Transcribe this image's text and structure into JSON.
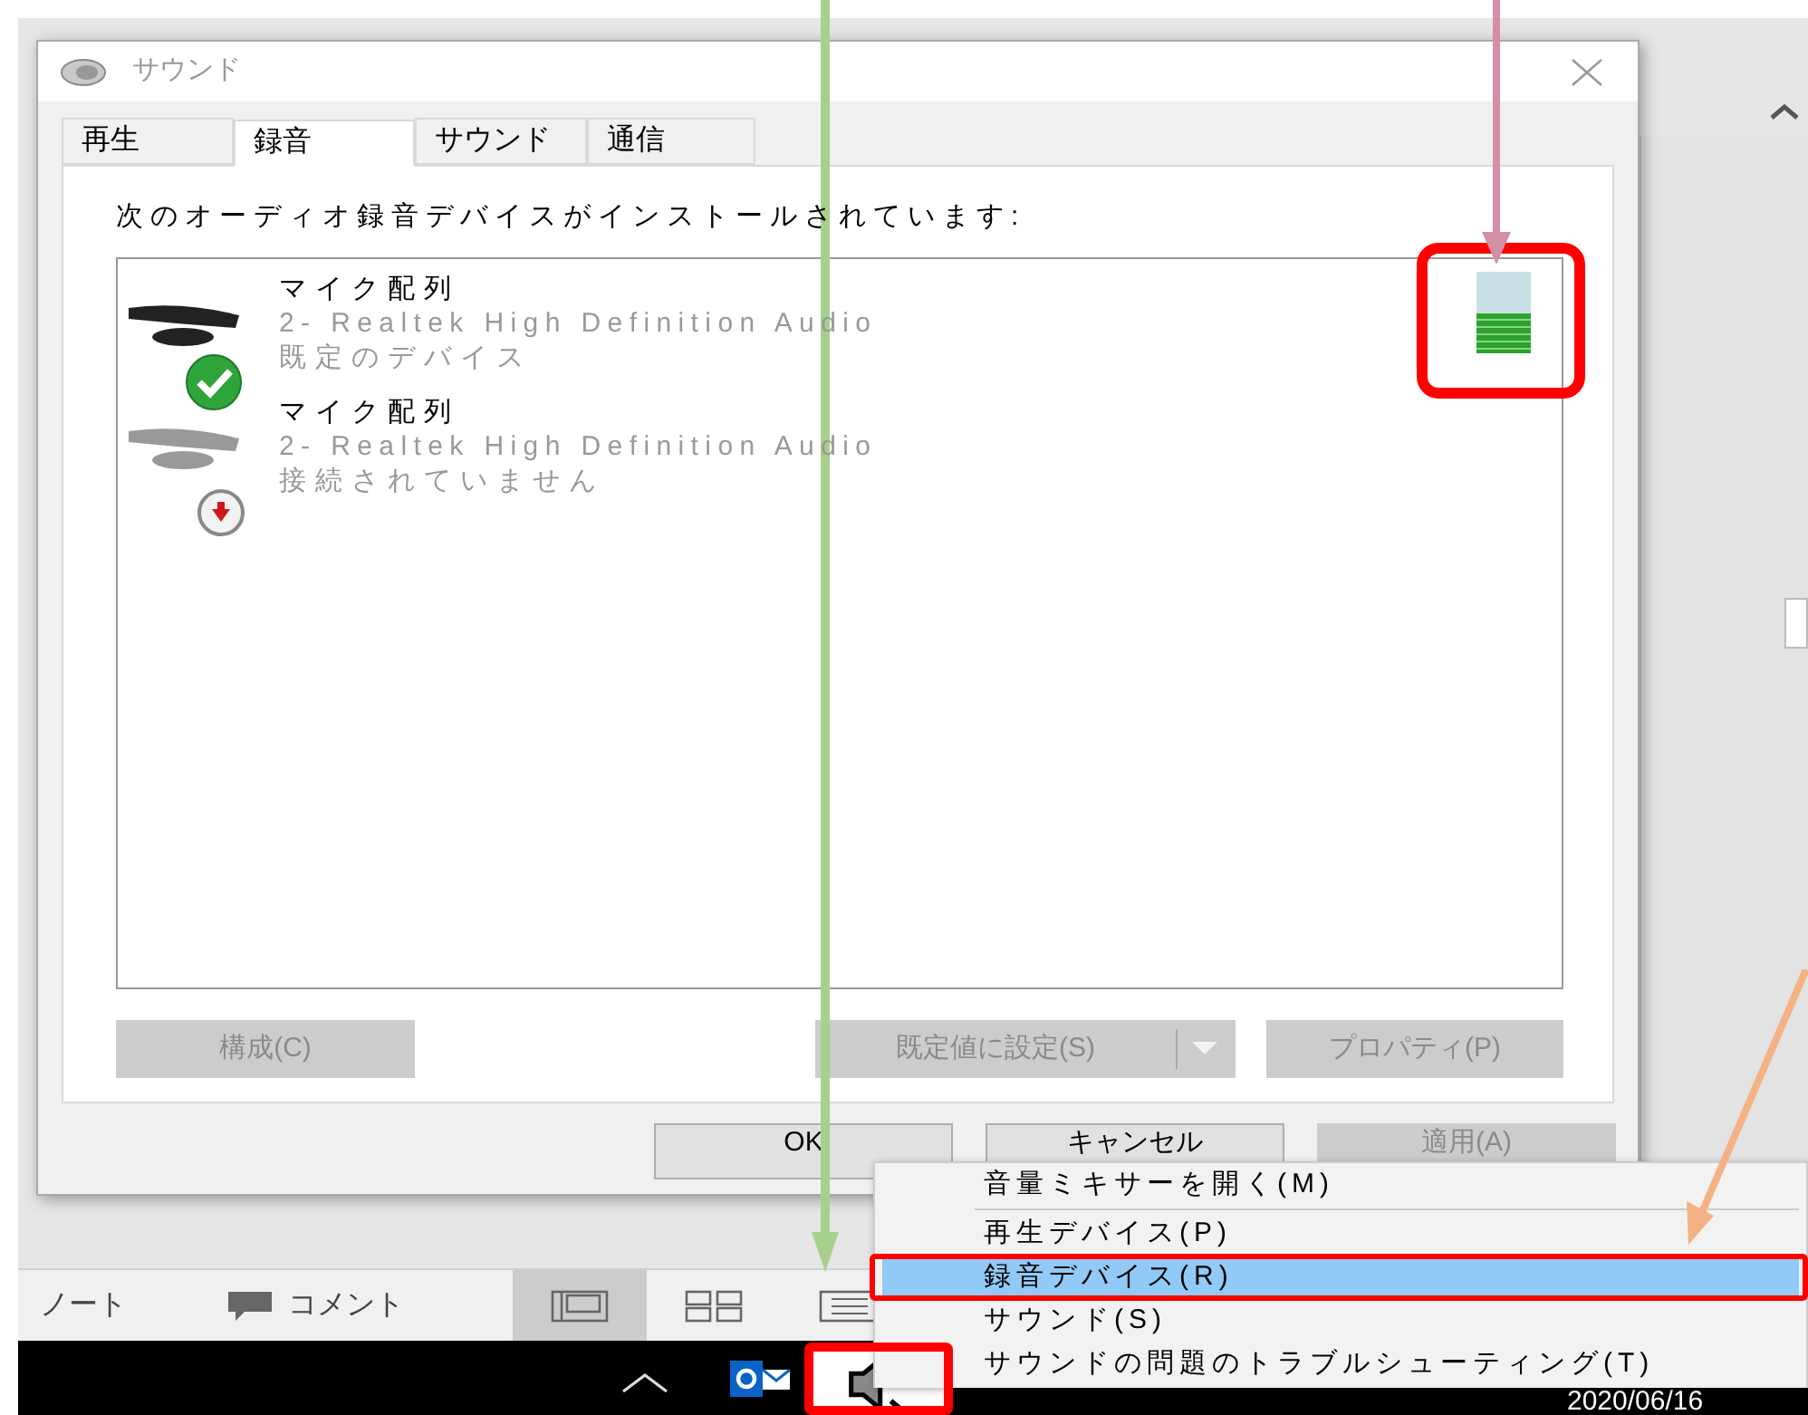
{
  "dialog": {
    "title": "サウンド",
    "tabs": [
      {
        "label": "再生",
        "selected": false
      },
      {
        "label": "録音",
        "selected": true
      },
      {
        "label": "サウンド",
        "selected": false
      },
      {
        "label": "通信",
        "selected": false
      }
    ],
    "heading": "次のオーディオ録音デバイスがインストールされています:",
    "devices": [
      {
        "name": "マイク配列",
        "driver": "2- Realtek High Definition Audio",
        "status": "既定のデバイス",
        "kind": "default",
        "level": 0.5
      },
      {
        "name": "マイク配列",
        "driver": "2- Realtek High Definition Audio",
        "status": "接続されていません",
        "kind": "disconnected"
      }
    ],
    "buttons": [
      {
        "label": "構成(C)",
        "kind": "plain",
        "disabled": true
      },
      {
        "label": "既定値に設定(S)",
        "kind": "split",
        "disabled": true
      },
      {
        "label": "プロパティ(P)",
        "kind": "plain",
        "disabled": true
      }
    ],
    "footer_buttons": [
      {
        "label": "OK",
        "disabled": false
      },
      {
        "label": "キャンセル",
        "disabled": false
      },
      {
        "label": "適用(A)",
        "disabled": true
      }
    ]
  },
  "background_app": {
    "status_items": [
      {
        "label": "ノート",
        "kind": "text"
      },
      {
        "label": "コメント",
        "kind": "comment"
      }
    ],
    "view_buttons": [
      {
        "kind": "normal",
        "selected": true
      },
      {
        "kind": "sorter",
        "selected": false
      },
      {
        "kind": "reading",
        "selected": false
      }
    ]
  },
  "context_menu": {
    "items": [
      {
        "label": "音量ミキサーを開く(M)",
        "kind": "item",
        "selected": false
      },
      {
        "kind": "separator"
      },
      {
        "label": "再生デバイス(P)",
        "kind": "item",
        "selected": false
      },
      {
        "label": "録音デバイス(R)",
        "kind": "item",
        "selected": true
      },
      {
        "label": "サウンド(S)",
        "kind": "item",
        "selected": false
      },
      {
        "label": "サウンドの問題のトラブルシューティング(T)",
        "kind": "item",
        "selected": false
      }
    ]
  },
  "taskbar": {
    "date": "2020/06/16"
  }
}
